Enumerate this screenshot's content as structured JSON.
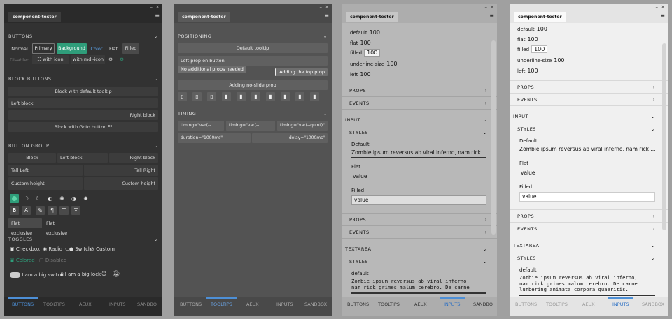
{
  "tab_title": "component-tester",
  "window_controls": {
    "minimize": "–",
    "close": "×"
  },
  "menu_glyph": "≡",
  "footer_tabs": [
    "BUTTONS",
    "TOOLTIPS",
    "AEUX",
    "INPUTS",
    "SANDBOX"
  ],
  "footer_tabs_short": [
    "BUTTONS",
    "TOOLTIPS",
    "AEUX",
    "INPUTS",
    "SANDBO"
  ],
  "colors": {
    "accent": "#4d8fd6",
    "primary_green": "#2f9d7a",
    "color_text": "#5aa0e6"
  },
  "buttons": {
    "heading": "BUTTONS",
    "normal": "Normal",
    "primary": "Primary",
    "background": "Background",
    "color": "Color",
    "flat": "Flat",
    "filled": "Filled",
    "disabled": "Disabled",
    "with_icon": "with icon",
    "with_mdi_icon": "with mdi-icon"
  },
  "block_buttons": {
    "heading": "BLOCK BUTTONS",
    "default_tooltip": "Block with default tooltip",
    "left": "Left block",
    "right": "Right block",
    "goto": "Block with Goto button"
  },
  "button_group": {
    "heading": "BUTTON GROUP",
    "row1": [
      "Block",
      "Left block",
      "Right block"
    ],
    "row2": [
      "Tall Left",
      "Tall Right"
    ],
    "row3": [
      "Custom height",
      "Custom height"
    ],
    "text_icons": [
      "B",
      "A"
    ],
    "flat_exclusive": "Flat exclusive"
  },
  "toggles": {
    "heading": "TOGGLES",
    "checkbox": "Checkbox",
    "radio": "Radio",
    "switch": "Switch",
    "custom": "Custom",
    "colored": "Colored",
    "disabled": "Disabled",
    "big_switch": "I am a big switch",
    "big_lock": "I am a big lock"
  },
  "positioning": {
    "heading": "POSITIONING",
    "default_tooltip": "Default tooltip",
    "left_prop": "Left prop on button",
    "no_props": "No additional props needed",
    "top_prop": "Adding the top prop",
    "no_slide": "Adding no-slide prop"
  },
  "timing": {
    "heading": "TIMING",
    "quad": "timing=\"var(--quad)\"",
    "quart": "timing=\"var(--quart)\"",
    "quint": "timing=\"var(--quint)\"",
    "duration": "duration=\"1000ms\"",
    "delay": "delay=\"1000ms\""
  },
  "inputs": {
    "kv": [
      {
        "key": "default",
        "value": "100"
      },
      {
        "key": "flat",
        "value": "100"
      },
      {
        "key": "filled",
        "value": "100"
      },
      {
        "key": "underline-size",
        "value": "100"
      },
      {
        "key": "left",
        "value": "100"
      }
    ],
    "props": "PROPS",
    "events": "EVENTS",
    "input": "INPUT",
    "styles": "STYLES",
    "default": "Default",
    "flat": "Flat",
    "filled": "Filled",
    "zombie_short": "Zombie ipsum reversus ab viral inferno, nam rick ...",
    "value": "value",
    "textarea": "TEXTAREA",
    "textarea_default": "default",
    "textarea_text_3": [
      "Zombie ipsum reversus ab viral inferno,",
      "nam rick grimes malum cerebro. De carne"
    ],
    "textarea_text_4": [
      "Zombie ipsum reversus ab viral inferno,",
      "nam rick grimes malum cerebro. De carne",
      "lumbering animata corpora quaeritis."
    ]
  }
}
